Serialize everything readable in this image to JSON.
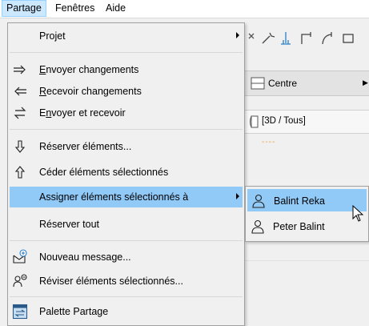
{
  "menubar": {
    "items": [
      {
        "label": "Partage",
        "active": true
      },
      {
        "label": "Fenêtres",
        "active": false
      },
      {
        "label": "Aide",
        "active": false
      }
    ]
  },
  "background": {
    "combo_label": "Centre",
    "view_label": "[3D / Tous]",
    "dashes": "----"
  },
  "menu": {
    "projet": "Projet",
    "envoyer_u": "E",
    "envoyer_rest": "nvoyer changements",
    "recevoir_u": "R",
    "recevoir_rest": "ecevoir changements",
    "envrec_pre": "E",
    "envrec_u": "n",
    "envrec_rest": "voyer et recevoir",
    "reserver_elements": "Réserver éléments...",
    "ceder": "Céder éléments sélectionnés",
    "assigner": "Assigner éléments sélectionnés à",
    "reserver_tout": "Réserver tout",
    "nouveau_message": "Nouveau message...",
    "reviser": "Réviser éléments sélectionnés...",
    "palette": "Palette Partage"
  },
  "submenu": {
    "items": [
      "Balint Reka",
      "Peter Balint"
    ]
  },
  "colors": {
    "highlight": "#91c9f7",
    "menubar_active": "#cce8ff",
    "menu_bg": "#f0f0f0"
  },
  "icons": [
    "arrow-right-icon",
    "arrow-left-icon",
    "swap-arrows-icon",
    "reserve-down-icon",
    "release-up-icon",
    "new-message-icon",
    "review-icon",
    "palette-icon",
    "user-icon",
    "mouse-cursor-icon"
  ]
}
